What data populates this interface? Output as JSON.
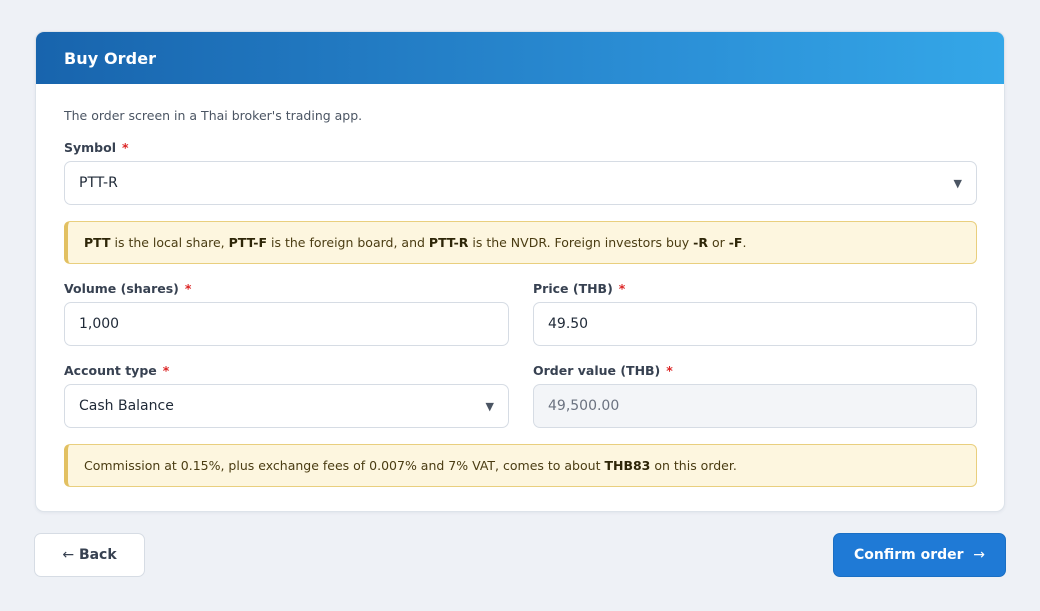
{
  "card": {
    "title": "Buy Order",
    "subtitle": "The order screen in a Thai broker's trading app."
  },
  "form": {
    "symbol": {
      "label": "Symbol",
      "required_mark": "*",
      "value": "PTT-R"
    },
    "volume": {
      "label": "Volume (shares)",
      "required_mark": "*",
      "value": "1,000"
    },
    "price": {
      "label": "Price (THB)",
      "required_mark": "*",
      "value": "49.50"
    },
    "account_type": {
      "label": "Account type",
      "required_mark": "*",
      "value": "Cash Balance"
    },
    "order_value": {
      "label": "Order value (THB)",
      "required_mark": "*",
      "value": "49,500.00"
    }
  },
  "notes": {
    "symbol_info": {
      "t1": "PTT",
      "t2": " is the local share, ",
      "t3": "PTT-F",
      "t4": " is the foreign board, and ",
      "t5": "PTT-R",
      "t6": " is the NVDR. Foreign investors buy ",
      "t7": "-R",
      "t8": " or ",
      "t9": "-F",
      "t10": "."
    },
    "fees_info": {
      "t1": "Commission at 0.15%, plus exchange fees of 0.007% and 7% VAT, comes to about ",
      "t2": "THB83",
      "t3": " on this order."
    }
  },
  "actions": {
    "back": {
      "arrow": "←",
      "label": "Back"
    },
    "confirm": {
      "label": "Confirm order",
      "arrow": "→"
    }
  },
  "icons": {
    "select_caret": "▼"
  },
  "colors": {
    "header_start": "#1864ad",
    "header_end": "#34a7e8",
    "primary_button": "#1f7ad6",
    "required": "#dc2626",
    "note_bg": "#fdf6df",
    "note_border": "#e2c061"
  }
}
